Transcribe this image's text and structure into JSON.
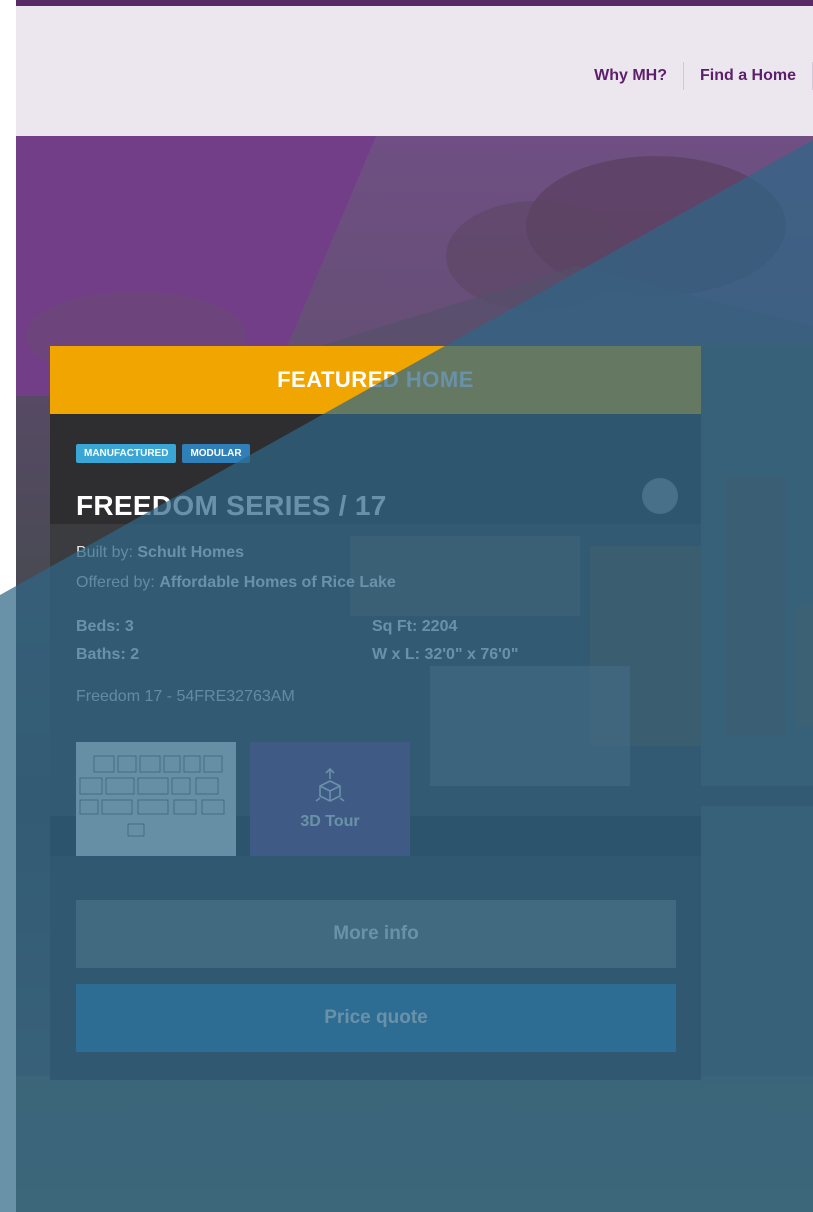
{
  "nav": {
    "items": [
      {
        "label": "Why MH?"
      },
      {
        "label": "Find a Home"
      }
    ]
  },
  "card": {
    "header": "FEATURED HOME",
    "badges": [
      "MANUFACTURED",
      "MODULAR"
    ],
    "title": "FREEDOM SERIES / 17",
    "built_by_label": "Built by:",
    "built_by_value": "Schult Homes",
    "offered_by_label": "Offered by:",
    "offered_by_value": "Affordable Homes of Rice Lake",
    "beds": "Beds: 3",
    "baths": "Baths: 2",
    "sqft": "Sq Ft: 2204",
    "dimensions": "W x L: 32'0\" x 76'0\"",
    "model": "Freedom 17 - 54FRE32763AM",
    "tour_label": "3D Tour",
    "more_info": "More info",
    "price_quote": "Price quote"
  },
  "colors": {
    "brand_purple": "#5c1f6c",
    "header_orange": "#f0a500",
    "overlay_blue": "#2f6686",
    "quote_blue": "#2a7ab2"
  },
  "icons": {
    "tour": "cube-3d-icon",
    "plan": "floorplan-thumbnail"
  }
}
